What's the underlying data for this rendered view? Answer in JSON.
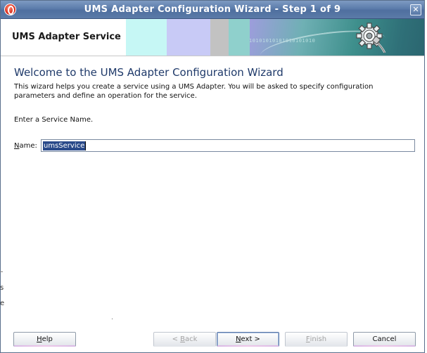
{
  "window": {
    "title": "UMS Adapter Configuration Wizard - Step 1 of 9",
    "close_glyph": "✕"
  },
  "banner": {
    "title": "UMS Adapter Service",
    "bits_text": "10101010101010101010",
    "icon": "gear-plug-icon"
  },
  "content": {
    "heading": "Welcome to the UMS Adapter Configuration Wizard",
    "description": "This wizard helps you create a service using a UMS Adapter. You will be asked to specify configuration parameters and define an operation for the service.",
    "prompt": "Enter a Service Name.",
    "name_field": {
      "label_mnemonic": "N",
      "label_rest": "ame:",
      "value": "umsService"
    }
  },
  "buttons": {
    "help": {
      "mnemonic": "H",
      "rest": "elp"
    },
    "back": {
      "prefix": "< ",
      "mnemonic": "B",
      "rest": "ack"
    },
    "next": {
      "mnemonic": "N",
      "rest": "ext >"
    },
    "finish": {
      "mnemonic": "F",
      "rest": "inish"
    },
    "cancel": {
      "label": "Cancel"
    }
  },
  "edge_artifacts": [
    "s",
    "e"
  ],
  "colors": {
    "titlebar": "#5c7cab",
    "heading": "#1f3a6a",
    "selection": "#2a4a8a"
  }
}
